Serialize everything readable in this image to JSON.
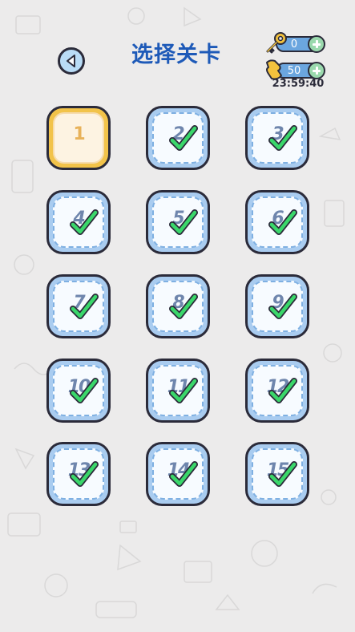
{
  "header": {
    "title": "选择关卡",
    "keys": "0",
    "energy": "50",
    "timer": "23:59:40"
  },
  "colors": {
    "title": "#1e5ab8",
    "tile_blue": "#a9ccf0",
    "tile_current": "#f2c34a",
    "check_green": "#3ad76a"
  },
  "icons": [
    "back-arrow-icon",
    "key-icon",
    "energy-icon",
    "plus-icon",
    "check-icon"
  ],
  "levels": [
    {
      "label": "1",
      "status": "current"
    },
    {
      "label": "2",
      "status": "completed"
    },
    {
      "label": "3",
      "status": "completed"
    },
    {
      "label": "4",
      "status": "completed"
    },
    {
      "label": "5",
      "status": "completed"
    },
    {
      "label": "6",
      "status": "completed"
    },
    {
      "label": "7",
      "status": "completed"
    },
    {
      "label": "8",
      "status": "completed"
    },
    {
      "label": "9",
      "status": "completed"
    },
    {
      "label": "10",
      "status": "completed"
    },
    {
      "label": "11",
      "status": "completed"
    },
    {
      "label": "12",
      "status": "completed"
    },
    {
      "label": "13",
      "status": "completed"
    },
    {
      "label": "14",
      "status": "completed"
    },
    {
      "label": "15",
      "status": "completed"
    }
  ]
}
